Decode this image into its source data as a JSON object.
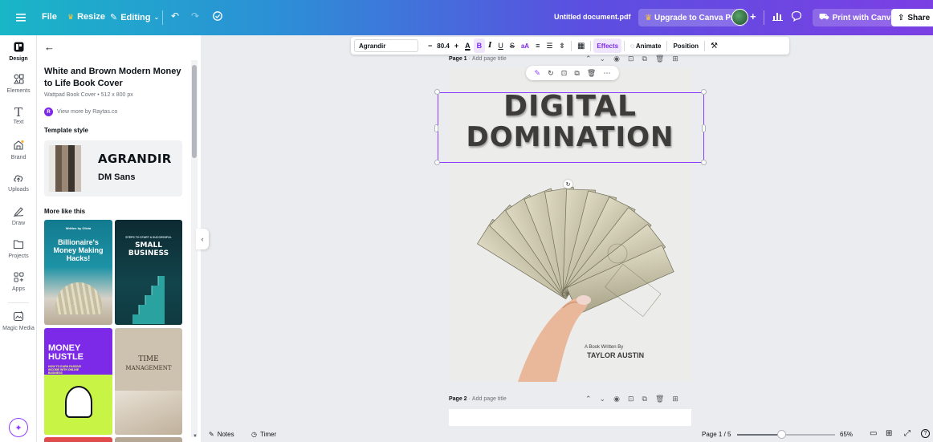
{
  "topbar": {
    "file": "File",
    "resize": "Resize",
    "editing": "Editing",
    "doc_title": "Untitled document.pdf",
    "upgrade": "Upgrade to Canva Pro",
    "print": "Print with Canva",
    "share": "Share"
  },
  "rail": [
    {
      "label": "Design",
      "icon": "design-icon"
    },
    {
      "label": "Elements",
      "icon": "elements-icon"
    },
    {
      "label": "Text",
      "icon": "text-icon"
    },
    {
      "label": "Brand",
      "icon": "brand-icon"
    },
    {
      "label": "Uploads",
      "icon": "uploads-icon"
    },
    {
      "label": "Draw",
      "icon": "draw-icon"
    },
    {
      "label": "Projects",
      "icon": "projects-icon"
    },
    {
      "label": "Apps",
      "icon": "apps-icon"
    },
    {
      "label": "Magic Media",
      "icon": "magic-media-icon"
    }
  ],
  "panel": {
    "title": "White and Brown Modern Money to Life Book Cover",
    "subtitle": "Wattpad Book Cover • 512 x 800 px",
    "author_initial": "R",
    "author": "View more by Raytas.co",
    "template_style": "Template style",
    "style_font_1": "AGRANDIR",
    "style_font_2": "DM Sans",
    "swatches": [
      "#e9e6e2",
      "#6b5a4b",
      "#9a8776",
      "#3a332e",
      "#c9bfb4"
    ],
    "more_like": "More like this",
    "thumbs": [
      {
        "line1": "Written by Olivia",
        "line2": "Billionaire's Money Making Hacks!"
      },
      {
        "line1": "STEPS TO START A SUCCESSFUL",
        "line2": "SMALL BUSINESS"
      },
      {
        "line1": "MONEY HUSTLE",
        "line2": "HOW TO EARN PASSIVE INCOME WITH ONLINE BUSINESS"
      },
      {
        "line1": "TIME",
        "line2": "MANAGEMENT"
      }
    ]
  },
  "toolbar": {
    "font": "Agrandir",
    "size": "80.4",
    "effects": "Effects",
    "animate": "Animate",
    "position": "Position"
  },
  "page1": {
    "label": "Page 1",
    "placeholder": "Add page title",
    "title_line1": "DIGITAL",
    "title_line2": "DOMINATION",
    "byline_small": "A Book Written By",
    "byline_name": "TAYLOR AUSTIN"
  },
  "page2": {
    "label": "Page 2",
    "placeholder": "Add page title"
  },
  "bottom": {
    "notes": "Notes",
    "timer": "Timer",
    "page_counter": "Page 1 / 5",
    "zoom": "65%",
    "zoom_slider_fraction": 0.45
  }
}
